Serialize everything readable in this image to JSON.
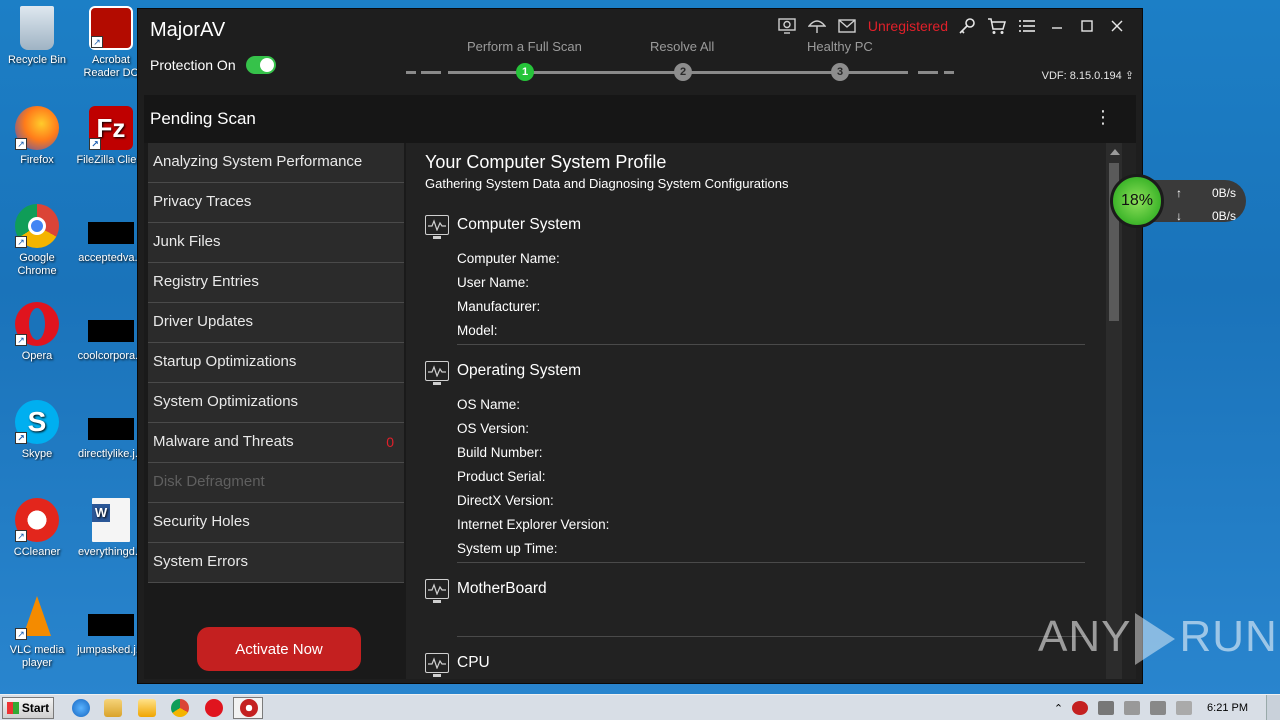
{
  "desktop": {
    "icons": [
      {
        "label": "Recycle Bin"
      },
      {
        "label": "Acrobat Reader DC"
      },
      {
        "label": "Firefox"
      },
      {
        "label": "FileZilla Client"
      },
      {
        "label": "Google Chrome"
      },
      {
        "label": "acceptedva..."
      },
      {
        "label": "Opera"
      },
      {
        "label": "coolcorpora..."
      },
      {
        "label": "Skype"
      },
      {
        "label": "directlylike.j..."
      },
      {
        "label": "CCleaner"
      },
      {
        "label": "everythingd..."
      },
      {
        "label": "VLC media player"
      },
      {
        "label": "jumpasked.j..."
      }
    ]
  },
  "app": {
    "title": "MajorAV",
    "protection_label": "Protection On",
    "protection_on": true,
    "unregistered": "Unregistered",
    "vdf": "VDF: 8.15.0.194",
    "steps": [
      {
        "label": "Perform a Full Scan",
        "num": "1",
        "active": true
      },
      {
        "label": "Resolve All",
        "num": "2",
        "active": false
      },
      {
        "label": "Healthy PC",
        "num": "3",
        "active": false
      }
    ],
    "pending_title": "Pending Scan",
    "kebab": "⋮",
    "sidebar": [
      {
        "label": "Analyzing System Performance",
        "count": ""
      },
      {
        "label": "Privacy Traces",
        "count": ""
      },
      {
        "label": "Junk Files",
        "count": ""
      },
      {
        "label": "Registry Entries",
        "count": ""
      },
      {
        "label": "Driver Updates",
        "count": ""
      },
      {
        "label": "Startup Optimizations",
        "count": ""
      },
      {
        "label": "System Optimizations",
        "count": ""
      },
      {
        "label": "Malware and Threats",
        "count": "0"
      },
      {
        "label": "Disk Defragment",
        "count": "",
        "disabled": true
      },
      {
        "label": "Security Holes",
        "count": ""
      },
      {
        "label": "System Errors",
        "count": ""
      }
    ],
    "activate_label": "Activate Now",
    "content": {
      "title": "Your Computer System Profile",
      "subtitle": "Gathering System Data and Diagnosing System Configurations",
      "sections": [
        {
          "heading": "Computer System",
          "fields": [
            "Computer Name:",
            "User Name:",
            "Manufacturer:",
            "Model:"
          ]
        },
        {
          "heading": "Operating System",
          "fields": [
            "OS Name:",
            "OS Version:",
            "Build Number:",
            "Product Serial:",
            "DirectX Version:",
            "Internet Explorer Version:",
            "System up Time:"
          ]
        },
        {
          "heading": "MotherBoard",
          "fields": []
        },
        {
          "heading": "CPU",
          "fields": []
        }
      ]
    }
  },
  "netmon": {
    "percent": "18%",
    "up": "0B/s",
    "down": "0B/s",
    "up_arrow": "↑",
    "down_arrow": "↓"
  },
  "watermark": {
    "left": "ANY",
    "right": "RUN"
  },
  "taskbar": {
    "start": "Start",
    "clock": "6:21 PM"
  },
  "colors": {
    "accent_green": "#26c43a",
    "danger_red": "#c42020",
    "unregistered_red": "#e0202a"
  }
}
